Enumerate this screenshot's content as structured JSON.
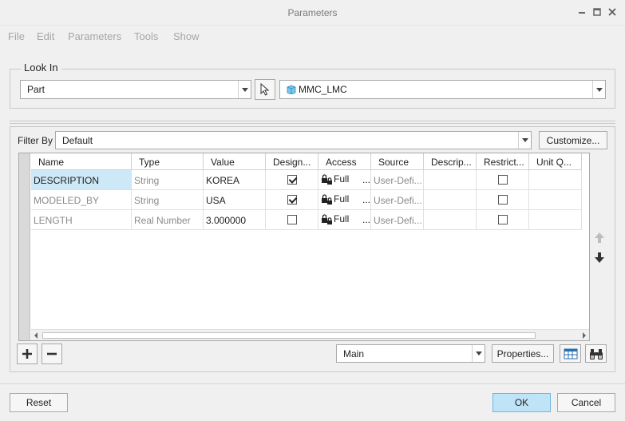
{
  "window": {
    "title": "Parameters"
  },
  "menu": [
    "File",
    "Edit",
    "Parameters",
    "Tools",
    "Show"
  ],
  "look_in": {
    "group_label": "Look In",
    "type_value": "Part",
    "object_value": "MMC_LMC"
  },
  "filter": {
    "label": "Filter By",
    "value": "Default",
    "customize_label": "Customize..."
  },
  "table": {
    "columns": [
      "Name",
      "Type",
      "Value",
      "Design...",
      "Access",
      "Source",
      "Descrip...",
      "Restrict...",
      "Unit Q..."
    ],
    "rows": [
      {
        "name": "DESCRIPTION",
        "type": "String",
        "value": "KOREA",
        "designate": true,
        "access": "Full",
        "more": "...",
        "source": "User-Defi...",
        "restricted": false
      },
      {
        "name": "MODELED_BY",
        "type": "String",
        "value": "USA",
        "designate": true,
        "access": "Full",
        "more": "...",
        "source": "User-Defi...",
        "restricted": false
      },
      {
        "name": "LENGTH",
        "type": "Real Number",
        "value": "3.000000",
        "designate": false,
        "access": "Full",
        "more": "...",
        "source": "User-Defi...",
        "restricted": false
      }
    ]
  },
  "bottom": {
    "set_value": "Main",
    "properties_label": "Properties..."
  },
  "footer": {
    "reset_label": "Reset",
    "ok_label": "OK",
    "cancel_label": "Cancel"
  },
  "colors": {
    "ok_button": "#bfe3f7",
    "selected_cell": "#cde8f6"
  }
}
